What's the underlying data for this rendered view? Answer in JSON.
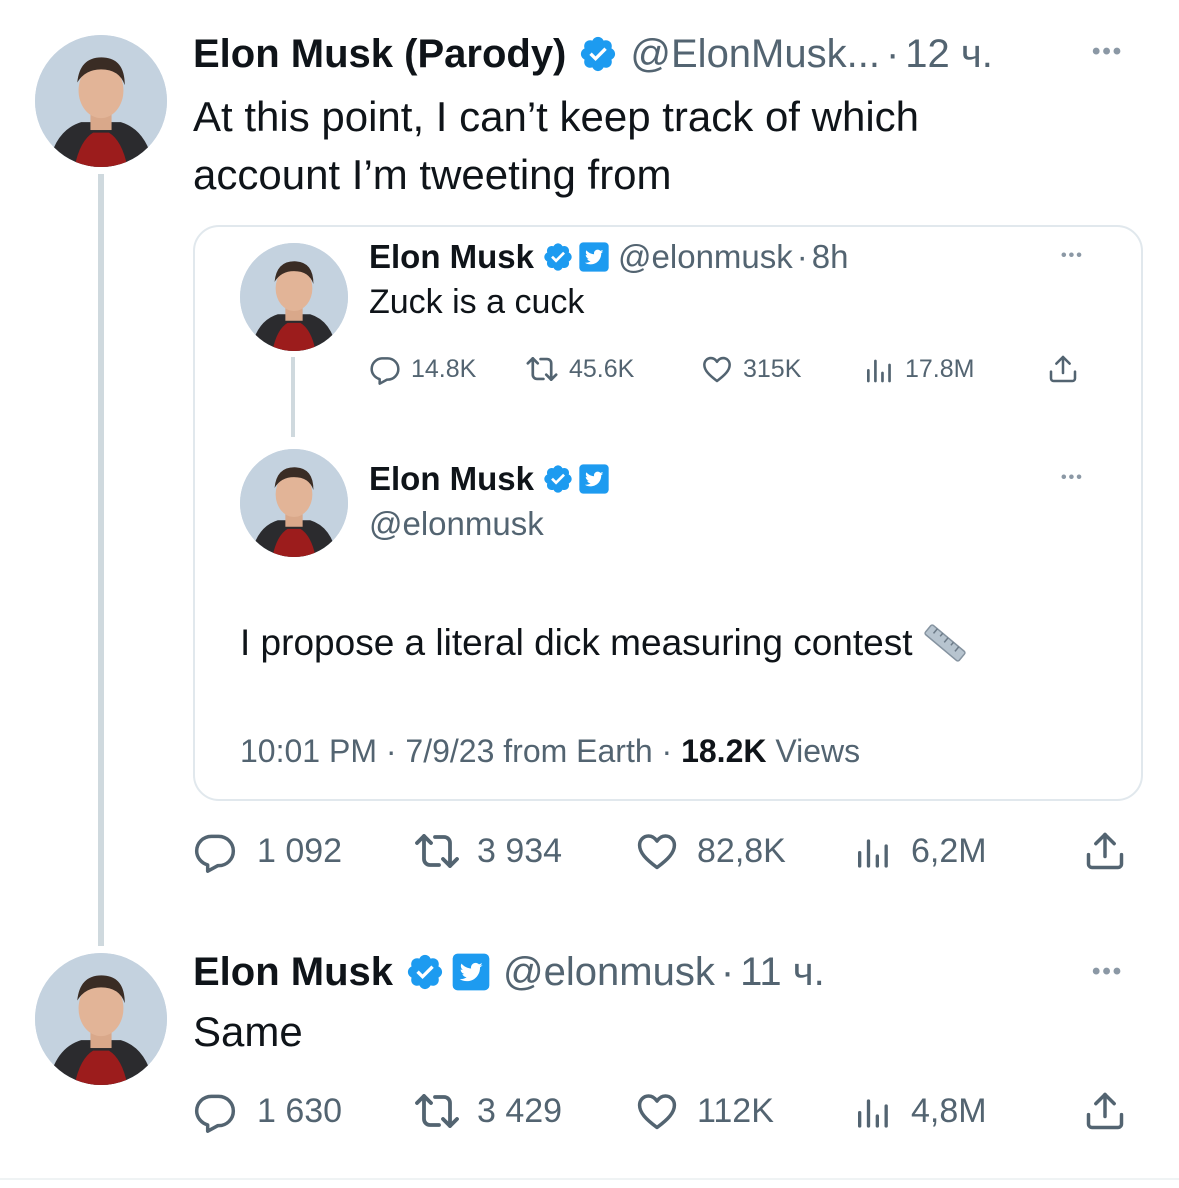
{
  "colors": {
    "accent": "#1d9bf0",
    "muted": "#536471",
    "line": "#cfd9de"
  },
  "tweet1": {
    "name": "Elon Musk (Parody)",
    "handle": "@ElonMusk...",
    "time": "12 ч.",
    "sep": "·",
    "text_line1": "At this point, I can’t keep track of which",
    "text_line2": "account I’m tweeting from",
    "more": "•••",
    "actions": {
      "replies": "1 092",
      "retweets": "3 934",
      "likes": "82,8K",
      "views": "6,2M"
    }
  },
  "quote": {
    "first": {
      "name": "Elon Musk",
      "handle": "@elonmusk",
      "sep": "·",
      "time": "8h",
      "text": "Zuck is a cuck",
      "more": "•••",
      "actions": {
        "replies": "14.8K",
        "retweets": "45.6K",
        "likes": "315K",
        "views": "17.8M"
      }
    },
    "second": {
      "name": "Elon Musk",
      "handle": "@elonmusk",
      "more": "•••",
      "text": "I propose a literal dick measuring contest",
      "timestamp": "10:01 PM · 7/9/23 from Earth · ",
      "views_count": "18.2K",
      "views_label": " Views"
    }
  },
  "tweet2": {
    "name": "Elon Musk",
    "handle": "@elonmusk",
    "sep": "·",
    "time": "11 ч.",
    "text": "Same",
    "more": "•••",
    "actions": {
      "replies": "1 630",
      "retweets": "3 429",
      "likes": "112K",
      "views": "4,8M"
    }
  }
}
